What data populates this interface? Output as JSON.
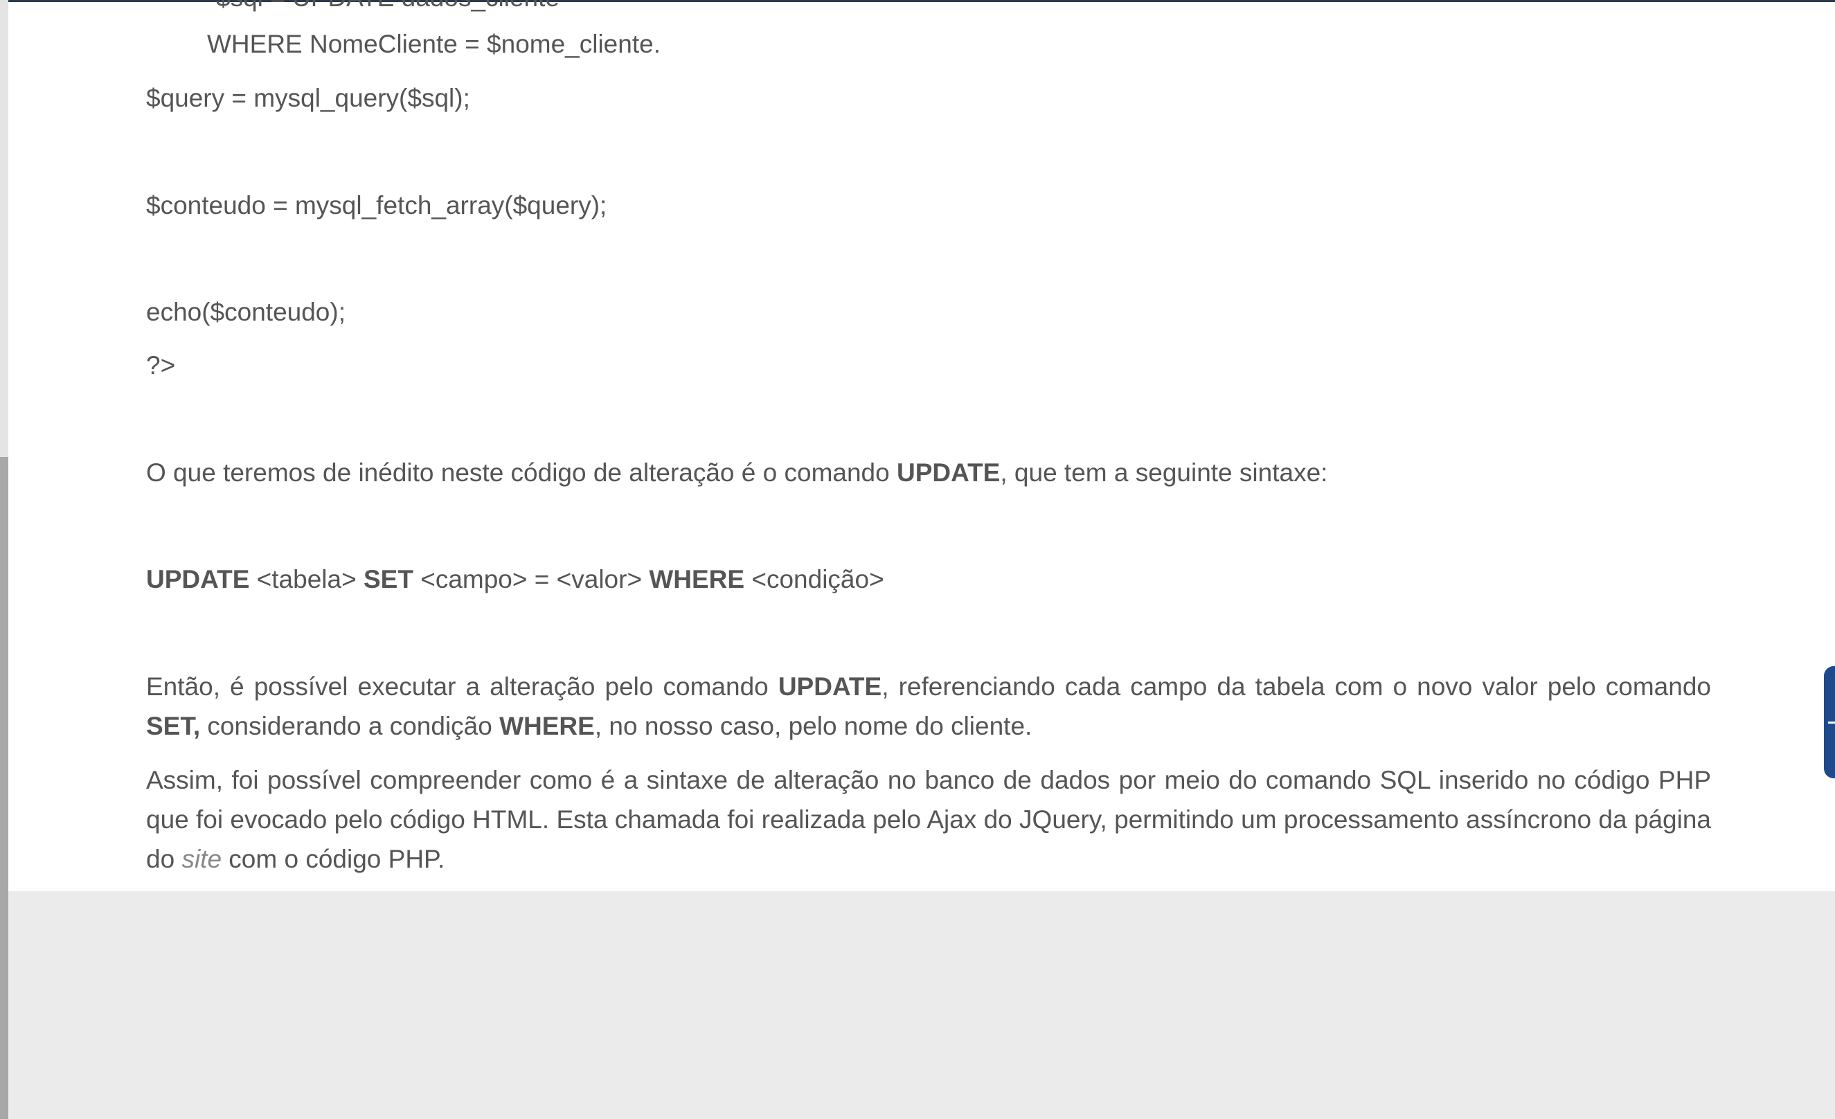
{
  "code": {
    "clipped_line": "$sql = UPDATE dados_cliente",
    "where_line": "WHERE NomeCliente = $nome_cliente.",
    "query_line": "$query = mysql_query($sql);",
    "fetch_line": "$conteudo = mysql_fetch_array($query);",
    "echo_line": "echo($conteudo);",
    "close_tag": "?>"
  },
  "paragraph1": {
    "before": "O que teremos de inédito neste código de alteração é o comando ",
    "bold": "UPDATE",
    "after": ", que tem a seguinte sintaxe:"
  },
  "syntax": {
    "kw_update": "UPDATE",
    "tabela": " <tabela> ",
    "kw_set": "SET",
    "campo": " <campo> = <valor> ",
    "kw_where": "WHERE",
    "condicao": " <condição>"
  },
  "paragraph2": {
    "t1": "Então, é possível executar a alteração pelo comando ",
    "b1": "UPDATE",
    "t2": ", referenciando cada campo da tabela com o novo valor pelo comando ",
    "b2": "SET,",
    "t3": " considerando a condição ",
    "b3": "WHERE",
    "t4": ", no nosso caso, pelo nome do cliente."
  },
  "paragraph3": {
    "t1": "Assim, foi possível compreender como é a sintaxe de alteração no banco de dados por meio do comando SQL inserido no código PHP que foi evocado pelo código HTML. Esta chamada foi realizada pelo Ajax do JQuery, permitindo um processamento assíncrono da página do ",
    "em": "site",
    "t2": " com o código PHP."
  },
  "colors": {
    "text": "#555555",
    "page_background": "#ebebeb",
    "card_background": "#ffffff",
    "accent_widget": "#1e4a8c",
    "top_border": "#2b3a4a"
  }
}
